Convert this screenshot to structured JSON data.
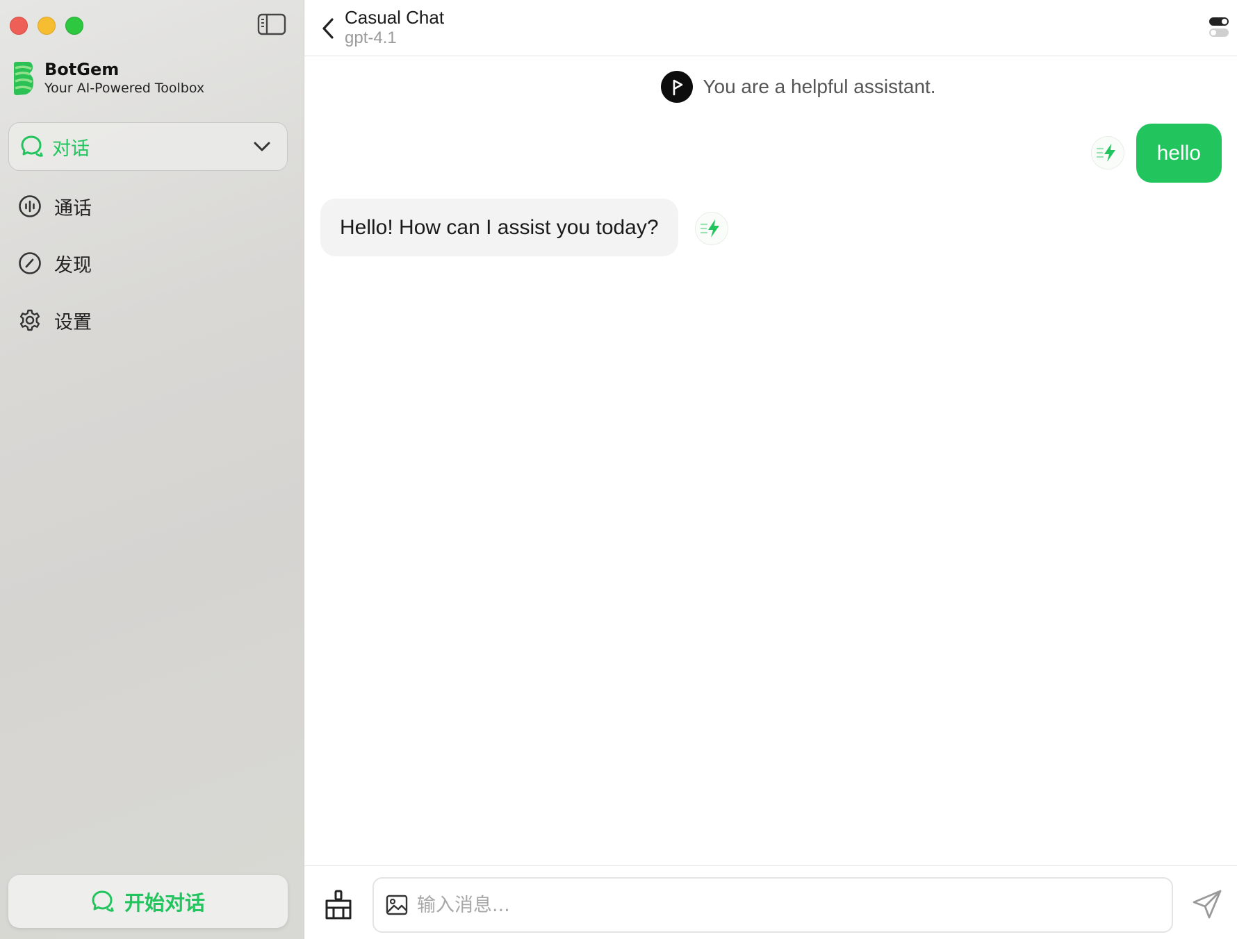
{
  "app": {
    "name": "BotGem",
    "tagline": "Your AI-Powered Toolbox"
  },
  "sidebar": {
    "selected": {
      "label": "对话",
      "icon": "chat-bubble-icon"
    },
    "items": [
      {
        "label": "通话",
        "icon": "voice-call-icon"
      },
      {
        "label": "发现",
        "icon": "compass-icon"
      },
      {
        "label": "设置",
        "icon": "gear-icon"
      }
    ],
    "start_button": "开始对话"
  },
  "header": {
    "title": "Casual Chat",
    "model": "gpt-4.1"
  },
  "chat": {
    "system_prompt": "You are a helpful assistant.",
    "messages": [
      {
        "role": "user",
        "text": "hello"
      },
      {
        "role": "assistant",
        "text": "Hello! How can I assist you today?"
      }
    ]
  },
  "composer": {
    "placeholder": "输入消息..."
  },
  "colors": {
    "accent": "#22c45e",
    "close": "#ee5f58",
    "minimize": "#f6bd30",
    "maximize": "#2dc740"
  }
}
